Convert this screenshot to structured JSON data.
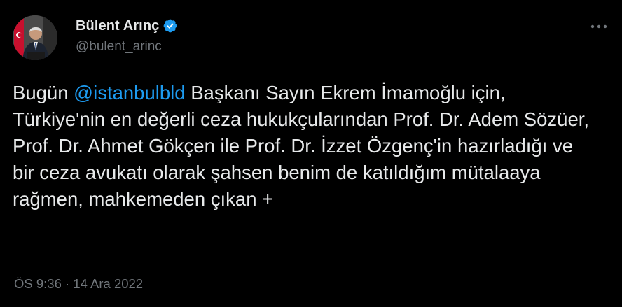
{
  "author": {
    "display_name": "Bülent Arınç",
    "handle": "@bulent_arinc",
    "verified_icon": "verified-badge-icon",
    "avatar_icon": "avatar"
  },
  "menu": {
    "more_icon": "more-options-icon"
  },
  "tweet": {
    "text_before_mention": "Bugün ",
    "mention": "@istanbulbld",
    "text_after_mention": " Başkanı Sayın Ekrem İmamoğlu için, Türkiye'nin en değerli ceza hukukçularından Prof. Dr. Adem Sözüer, Prof. Dr. Ahmet Gökçen ile Prof. Dr. İzzet Özgenç'in hazırladığı ve bir ceza avukatı olarak şahsen benim de katıldığım mütalaaya rağmen, mahkemeden çıkan +",
    "timestamp": "ÖS 9:36 · 14 Ara 2022"
  },
  "colors": {
    "background": "#000000",
    "text": "#e7e9ea",
    "secondary_text": "#71767b",
    "link": "#1d9bf0",
    "verified": "#1d9bf0"
  }
}
